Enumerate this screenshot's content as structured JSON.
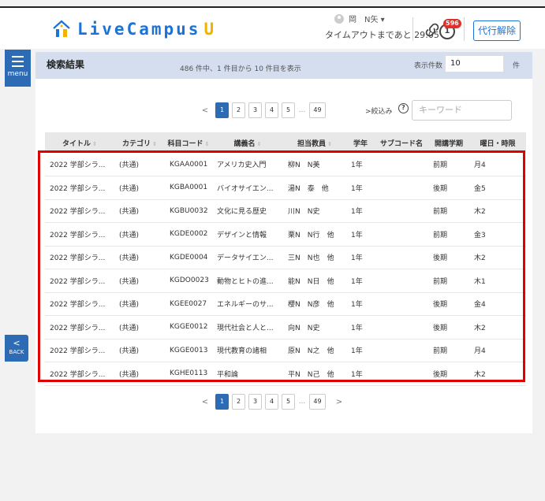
{
  "header": {
    "logo_main": "LiveCampus",
    "logo_u": "U",
    "user_label": "岡　N矢 ▾",
    "timeout_text": "タイムアウトまであと 29:05",
    "badge_count": "596",
    "clock_digit": "1",
    "proxy_button": "代行解除"
  },
  "sidebar": {
    "menu_label": "menu",
    "back_label": "BACK"
  },
  "titlebar": {
    "title": "検索結果",
    "count_text": "486 件中、1 件目から 10 件目を表示",
    "per_page_label": "表示件数",
    "per_page_value": "10",
    "per_page_unit": "件"
  },
  "filter": {
    "label": ">絞込み",
    "help": "?",
    "keyword_placeholder": "キーワード"
  },
  "pager": {
    "prev": "<",
    "next": ">",
    "pages": [
      "1",
      "2",
      "3",
      "4",
      "5"
    ],
    "ellipsis": "...",
    "last": "49"
  },
  "table": {
    "columns": [
      "タイトル",
      "カテゴリ",
      "科目コード",
      "講義名",
      "担当教員",
      "学年",
      "サブコード名",
      "開講学期",
      "曜日・時限"
    ],
    "rows": [
      [
        "2022 学部シラ...",
        "(共通)",
        "KGAA0001",
        "アメリカ史入門",
        "柳N　N美",
        "1年",
        "",
        "前期",
        "月4"
      ],
      [
        "2022 学部シラ...",
        "(共通)",
        "KGBA0001",
        "バイオサイエン...",
        "湯N　泰　他",
        "1年",
        "",
        "後期",
        "金5"
      ],
      [
        "2022 学部シラ...",
        "(共通)",
        "KGBU0032",
        "文化に見る歴史",
        "川N　N史",
        "1年",
        "",
        "前期",
        "木2"
      ],
      [
        "2022 学部シラ...",
        "(共通)",
        "KGDE0002",
        "デザインと情報",
        "栗N　N行　他",
        "1年",
        "",
        "前期",
        "金3"
      ],
      [
        "2022 学部シラ...",
        "(共通)",
        "KGDE0004",
        "データサイエン...",
        "三N　N也　他",
        "1年",
        "",
        "後期",
        "木2"
      ],
      [
        "2022 学部シラ...",
        "(共通)",
        "KGDO0023",
        "動物とヒトの進...",
        "能N　N日　他",
        "1年",
        "",
        "前期",
        "木1"
      ],
      [
        "2022 学部シラ...",
        "(共通)",
        "KGEE0027",
        "エネルギーのサ...",
        "櫻N　N彦　他",
        "1年",
        "",
        "後期",
        "金4"
      ],
      [
        "2022 学部シラ...",
        "(共通)",
        "KGGE0012",
        "現代社会と人と...",
        "向N　N史",
        "1年",
        "",
        "後期",
        "木2"
      ],
      [
        "2022 学部シラ...",
        "(共通)",
        "KGGE0013",
        "現代教育の諸相",
        "原N　N之　他",
        "1年",
        "",
        "前期",
        "月4"
      ],
      [
        "2022 学部シラ...",
        "(共通)",
        "KGHE0113",
        "平和論",
        "平N　N己　他",
        "1年",
        "",
        "後期",
        "木2"
      ]
    ]
  },
  "colors": {
    "brand": "#1a73d9",
    "accent": "#f0b400",
    "nav": "#2d6bb5",
    "highlight": "#e00000"
  }
}
